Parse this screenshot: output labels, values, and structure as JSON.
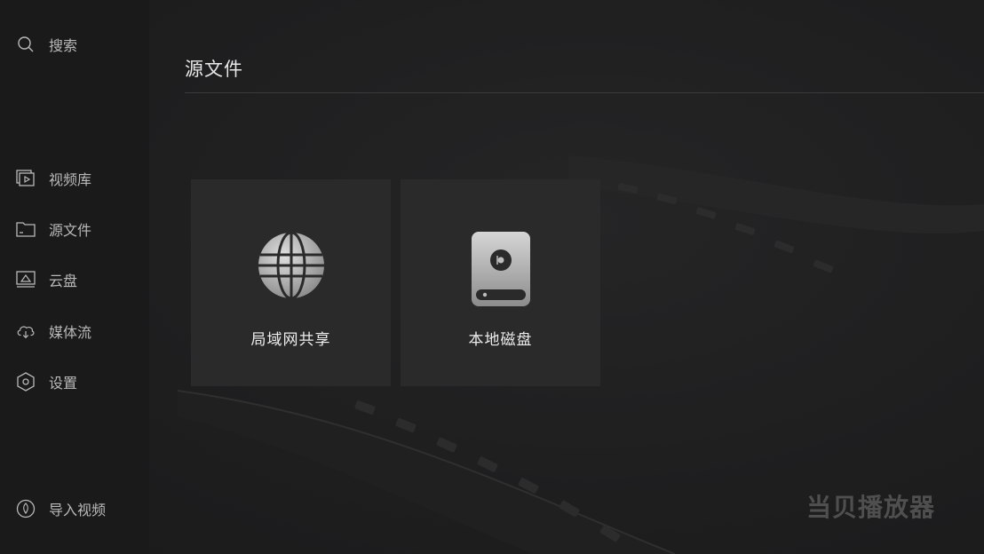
{
  "sidebar": {
    "search": {
      "label": "搜索",
      "icon": "search-icon"
    },
    "items": [
      {
        "label": "视频库",
        "icon": "video-library-icon"
      },
      {
        "label": "源文件",
        "icon": "folder-icon"
      },
      {
        "label": "云盘",
        "icon": "cloud-drive-icon"
      },
      {
        "label": "媒体流",
        "icon": "cloud-stream-icon"
      },
      {
        "label": "设置",
        "icon": "settings-hexagon-icon"
      }
    ],
    "import": {
      "label": "导入视频",
      "icon": "import-pin-icon"
    }
  },
  "main": {
    "title": "源文件",
    "cards": [
      {
        "label": "局域网共享",
        "icon": "globe-icon"
      },
      {
        "label": "本地磁盘",
        "icon": "hard-disk-icon"
      }
    ]
  },
  "watermark": {
    "text": "当贝播放器"
  },
  "colors": {
    "background": "#1d1d1e",
    "sidebar": "#1a1a1b",
    "card": "#2a2a2b",
    "text_primary": "#ededed",
    "text_secondary": "#b9b9b9"
  }
}
